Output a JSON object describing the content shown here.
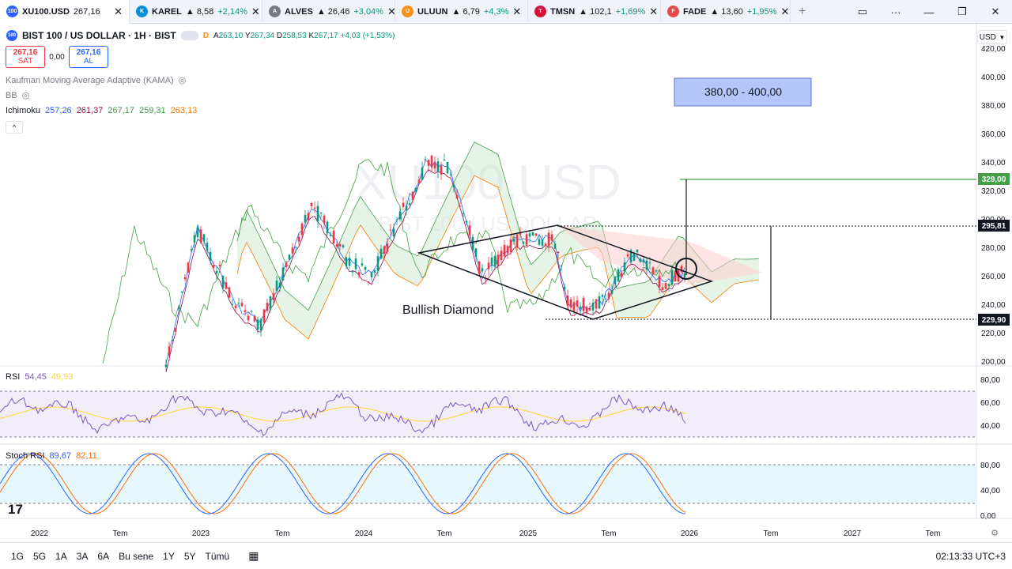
{
  "tabs": [
    {
      "icon": "100",
      "icon_color": "#2962ff",
      "symbol": "XU100.USD",
      "price": "267,16",
      "change": "",
      "active": true
    },
    {
      "icon": "K",
      "icon_color": "#0a8fd8",
      "symbol": "KAREL",
      "price": "▲ 8,58",
      "change": "+2,14%",
      "active": false
    },
    {
      "icon": "A",
      "icon_color": "#787b86",
      "symbol": "ALVES",
      "price": "▲ 26,46",
      "change": "+3,04%",
      "active": false
    },
    {
      "icon": "U",
      "icon_color": "#f7931a",
      "symbol": "ULUUN",
      "price": "▲ 6,79",
      "change": "+4,3%",
      "active": false
    },
    {
      "icon": "T",
      "icon_color": "#d5143c",
      "symbol": "TMSN",
      "price": "▲ 102,1",
      "change": "+1,69%",
      "active": false
    },
    {
      "icon": "F",
      "icon_color": "#e84a4a",
      "symbol": "FADE",
      "price": "▲ 13,60",
      "change": "+1,95%",
      "active": false
    }
  ],
  "header": {
    "logo": "100",
    "title": "BIST 100 / US DOLLAR · 1H · BIST",
    "d_badge": "D",
    "ohlc": {
      "a": "263,10",
      "y": "267,34",
      "d": "258,53",
      "k": "267,17",
      "chg": "+4,03 (+1,53%)"
    },
    "labels": {
      "a": "A",
      "y": "Y",
      "d": "D",
      "k": "K"
    }
  },
  "trade": {
    "sell_price": "267,16",
    "sell_label": "SAT",
    "spread": "0,00",
    "buy_price": "267,16",
    "buy_label": "AL"
  },
  "indicators": {
    "kama": "Kaufman Moving Average Adaptive (KAMA)",
    "bb": "BB",
    "ichimoku_name": "Ichimoku",
    "ichimoku_values": [
      "257,26",
      "261,37",
      "267,17",
      "259,31",
      "263,13"
    ],
    "ichimoku_colors": [
      "#2962ff",
      "#880e4f",
      "#43a047",
      "#43a047",
      "#f57c00"
    ]
  },
  "currency": "USD",
  "watermark": {
    "symbol": "XU100.USD",
    "name": "BIST 100 / US DOLLAR"
  },
  "annotations": {
    "target_box": "380,00 - 400,00",
    "pattern_label": "Bullish Diamond",
    "level_329": "329,00",
    "level_295": "295,81",
    "level_229": "229,90"
  },
  "price_axis": [
    "420,00",
    "400,00",
    "380,00",
    "360,00",
    "340,00",
    "320,00",
    "300,00",
    "280,00",
    "260,00",
    "240,00",
    "220,00",
    "200,00"
  ],
  "rsi": {
    "name": "RSI",
    "v1": "54,45",
    "v2": "49,93",
    "axis": [
      "80,00",
      "60,00",
      "40,00"
    ]
  },
  "stoch": {
    "name": "Stoch RSI",
    "v1": "89,67",
    "v2": "82,11",
    "axis": [
      "80,00",
      "40,00",
      "0,00"
    ]
  },
  "time_axis": [
    "2022",
    "Tem",
    "2023",
    "Tem",
    "2024",
    "Tem",
    "2025",
    "Tem",
    "2026",
    "Tem",
    "2027",
    "Tem"
  ],
  "ranges": [
    "1G",
    "5G",
    "1A",
    "3A",
    "6A",
    "Bu sene",
    "1Y",
    "5Y",
    "Tümü"
  ],
  "clock": "02:13:33 UTC+3",
  "colors": {
    "up": "#089981",
    "down": "#f23645",
    "accent": "#2962ff"
  }
}
